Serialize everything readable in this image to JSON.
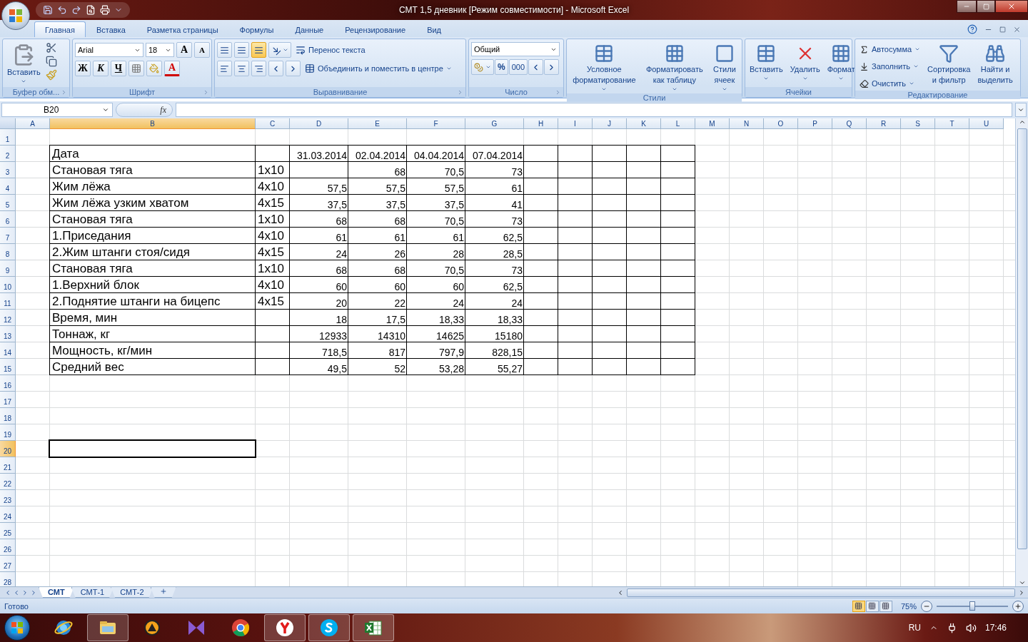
{
  "window": {
    "title": "СМТ 1,5 дневник  [Режим совместимости] - Microsoft Excel"
  },
  "tabs": [
    {
      "label": "Главная",
      "selected": true
    },
    {
      "label": "Вставка",
      "selected": false
    },
    {
      "label": "Разметка страницы",
      "selected": false
    },
    {
      "label": "Формулы",
      "selected": false
    },
    {
      "label": "Данные",
      "selected": false
    },
    {
      "label": "Рецензирование",
      "selected": false
    },
    {
      "label": "Вид",
      "selected": false
    }
  ],
  "ribbon": {
    "groups": [
      {
        "kind": "clipboard",
        "label": "Буфер обм...",
        "paste": "Вставить"
      },
      {
        "kind": "font",
        "label": "Шрифт",
        "font": "Arial",
        "size": "18",
        "grow": "A",
        "shrink": "A",
        "bold": "Ж",
        "italic": "К",
        "underline": "Ч",
        "color_letter": "A"
      },
      {
        "kind": "alignment",
        "label": "Выравнивание",
        "vertical": [
          {
            "selected": false
          },
          {
            "selected": false
          },
          {
            "selected": true
          }
        ],
        "wrap": "Перенос текста",
        "merge": "Объединить и поместить в центре"
      },
      {
        "kind": "number",
        "label": "Число",
        "format": "Общий",
        "percent": "%",
        "thousands": "000"
      },
      {
        "kind": "styles",
        "label": "Стили",
        "buttons": [
          {
            "lines": [
              "Условное",
              "форматирование"
            ]
          },
          {
            "lines": [
              "Форматировать",
              "как таблицу"
            ]
          },
          {
            "lines": [
              "Стили",
              "ячеек"
            ]
          }
        ]
      },
      {
        "kind": "cells",
        "label": "Ячейки",
        "buttons": [
          {
            "lines": [
              "Вставить"
            ]
          },
          {
            "lines": [
              "Удалить"
            ]
          },
          {
            "lines": [
              "Формат"
            ]
          }
        ]
      },
      {
        "kind": "editing",
        "label": "Редактирование",
        "small": [
          "Автосумма",
          "Заполнить",
          "Очистить"
        ],
        "buttons": [
          {
            "lines": [
              "Сортировка",
              "и фильтр"
            ]
          },
          {
            "lines": [
              "Найти и",
              "выделить"
            ]
          }
        ]
      }
    ]
  },
  "formula_bar": {
    "name_box": "B20",
    "fx": "fx"
  },
  "sheet": {
    "columns": [
      {
        "letter": "A",
        "selected": false
      },
      {
        "letter": "B",
        "selected": true
      },
      {
        "letter": "C",
        "selected": false
      },
      {
        "letter": "D",
        "selected": false
      },
      {
        "letter": "E",
        "selected": false
      },
      {
        "letter": "F",
        "selected": false
      },
      {
        "letter": "G",
        "selected": false
      },
      {
        "letter": "H",
        "selected": false
      },
      {
        "letter": "I",
        "selected": false
      },
      {
        "letter": "J",
        "selected": false
      },
      {
        "letter": "K",
        "selected": false
      },
      {
        "letter": "L",
        "selected": false
      },
      {
        "letter": "M",
        "selected": false
      },
      {
        "letter": "N",
        "selected": false
      },
      {
        "letter": "O",
        "selected": false
      },
      {
        "letter": "P",
        "selected": false
      },
      {
        "letter": "Q",
        "selected": false
      },
      {
        "letter": "R",
        "selected": false
      },
      {
        "letter": "S",
        "selected": false
      },
      {
        "letter": "T",
        "selected": false
      },
      {
        "letter": "U",
        "selected": false
      }
    ],
    "row_headers": [
      {
        "number": "1",
        "selected": false
      },
      {
        "number": "2",
        "selected": false
      },
      {
        "number": "3",
        "selected": false
      },
      {
        "number": "4",
        "selected": false
      },
      {
        "number": "5",
        "selected": false
      },
      {
        "number": "6",
        "selected": false
      },
      {
        "number": "7",
        "selected": false
      },
      {
        "number": "8",
        "selected": false
      },
      {
        "number": "9",
        "selected": false
      },
      {
        "number": "10",
        "selected": false
      },
      {
        "number": "11",
        "selected": false
      },
      {
        "number": "12",
        "selected": false
      },
      {
        "number": "13",
        "selected": false
      },
      {
        "number": "14",
        "selected": false
      },
      {
        "number": "15",
        "selected": false
      },
      {
        "number": "16",
        "selected": false
      },
      {
        "number": "17",
        "selected": false
      },
      {
        "number": "18",
        "selected": false
      },
      {
        "number": "19",
        "selected": false
      },
      {
        "number": "20",
        "selected": true
      },
      {
        "number": "21",
        "selected": false
      },
      {
        "number": "22",
        "selected": false
      },
      {
        "number": "23",
        "selected": false
      },
      {
        "number": "24",
        "selected": false
      },
      {
        "number": "25",
        "selected": false
      },
      {
        "number": "26",
        "selected": false
      },
      {
        "number": "27",
        "selected": false
      },
      {
        "number": "28",
        "selected": false
      }
    ],
    "rows": [
      {
        "bordered": false
      },
      {
        "bordered": true,
        "cells": {
          "B": "Дата",
          "D": "31.03.2014",
          "E": "02.04.2014",
          "F": "04.04.2014",
          "G": "07.04.2014"
        }
      },
      {
        "bordered": true,
        "cells": {
          "B": "Становая тяга",
          "C": "1x10",
          "E": "68",
          "F": "70,5",
          "G": "73"
        }
      },
      {
        "bordered": true,
        "cells": {
          "B": "Жим лёжа",
          "C": "4x10",
          "D": "57,5",
          "E": "57,5",
          "F": "57,5",
          "G": "61"
        }
      },
      {
        "bordered": true,
        "cells": {
          "B": "Жим лёжа узким хватом",
          "C": "4x15",
          "D": "37,5",
          "E": "37,5",
          "F": "37,5",
          "G": "41"
        }
      },
      {
        "bordered": true,
        "cells": {
          "B": "Становая тяга",
          "C": "1x10",
          "D": "68",
          "E": "68",
          "F": "70,5",
          "G": "73"
        }
      },
      {
        "bordered": true,
        "cells": {
          "B": "1.Приседания",
          "C": "4x10",
          "D": "61",
          "E": "61",
          "F": "61",
          "G": "62,5"
        }
      },
      {
        "bordered": true,
        "cells": {
          "B": "2.Жим штанги стоя/сидя",
          "C": "4x15",
          "D": "24",
          "E": "26",
          "F": "28",
          "G": "28,5"
        }
      },
      {
        "bordered": true,
        "cells": {
          "B": "Становая тяга",
          "C": "1x10",
          "D": "68",
          "E": "68",
          "F": "70,5",
          "G": "73"
        }
      },
      {
        "bordered": true,
        "cells": {
          "B": "1.Верхний блок",
          "C": "4x10",
          "D": "60",
          "E": "60",
          "F": "60",
          "G": "62,5"
        }
      },
      {
        "bordered": true,
        "cells": {
          "B": "2.Поднятие штанги на бицепс",
          "C": "4x15",
          "D": "20",
          "E": "22",
          "F": "24",
          "G": "24"
        }
      },
      {
        "bordered": true,
        "cells": {
          "B": "Время, мин",
          "D": "18",
          "E": "17,5",
          "F": "18,33",
          "G": "18,33"
        }
      },
      {
        "bordered": true,
        "cells": {
          "B": "Тоннаж, кг",
          "D": "12933",
          "E": "14310",
          "F": "14625",
          "G": "15180"
        }
      },
      {
        "bordered": true,
        "cells": {
          "B": "Мощность, кг/мин",
          "D": "718,5",
          "E": "817",
          "F": "797,9",
          "G": "828,15"
        }
      },
      {
        "bordered": true,
        "cells": {
          "B": "Средний вес",
          "D": "49,5",
          "E": "52",
          "F": "53,28",
          "G": "55,27"
        }
      },
      {
        "bordered": false
      },
      {
        "bordered": false
      },
      {
        "bordered": false
      },
      {
        "bordered": false
      },
      {
        "bordered": false
      },
      {
        "bordered": false
      },
      {
        "bordered": false
      },
      {
        "bordered": false
      },
      {
        "bordered": false
      },
      {
        "bordered": false
      },
      {
        "bordered": false
      },
      {
        "bordered": false
      },
      {
        "bordered": false
      }
    ]
  },
  "sheet_tabs": [
    {
      "label": "СМТ",
      "selected": true
    },
    {
      "label": "СМТ-1",
      "selected": false
    },
    {
      "label": "СМТ-2",
      "selected": false
    }
  ],
  "status_bar": {
    "status": "Готово",
    "views": [
      {
        "selected": true
      },
      {
        "selected": false
      },
      {
        "selected": false
      }
    ],
    "zoom": "75%",
    "zoom_level": {
      "level": 0.5
    }
  },
  "taskbar": {
    "apps": [
      {
        "kind": "ie",
        "running": false
      },
      {
        "kind": "folder",
        "running": true
      },
      {
        "kind": "aimp",
        "running": false
      },
      {
        "kind": "studio",
        "running": false
      },
      {
        "kind": "chrome",
        "running": false
      },
      {
        "kind": "yandex",
        "running": true
      },
      {
        "kind": "skype",
        "running": true
      },
      {
        "kind": "excel",
        "running": true
      }
    ],
    "language": "RU",
    "clock": "17:46"
  }
}
